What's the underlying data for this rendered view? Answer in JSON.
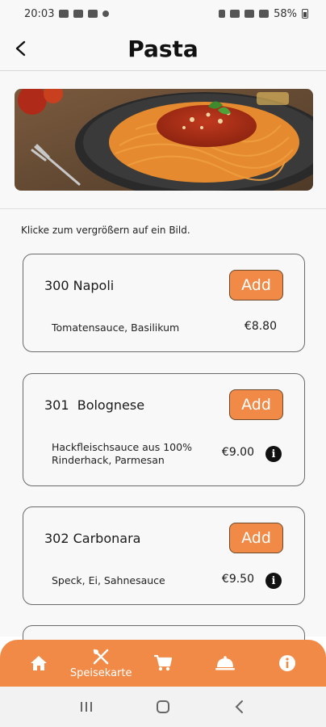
{
  "status_bar": {
    "time": "20:03",
    "battery": "58%"
  },
  "header": {
    "title": "Pasta"
  },
  "hint": "Klicke zum vergrößern auf ein Bild.",
  "menu_items": [
    {
      "name": "300 Napoli",
      "description": "Tomatensauce, Basilikum",
      "price": "€8.80",
      "add_label": "Add",
      "has_info": false
    },
    {
      "name": "301  Bolognese",
      "description_lines": [
        "Hackfleischsauce aus 100%",
        "Rinderhack, Parmesan"
      ],
      "price": "€9.00",
      "add_label": "Add",
      "has_info": true
    },
    {
      "name": "302 Carbonara",
      "description": "Speck, Ei, Sahnesauce",
      "price": "€9.50",
      "add_label": "Add",
      "has_info": true
    }
  ],
  "bottom_nav": {
    "items": [
      {
        "icon": "home-icon"
      },
      {
        "icon": "cutlery-icon",
        "label": "Speisekarte",
        "active": true
      },
      {
        "icon": "cart-icon"
      },
      {
        "icon": "cloche-icon"
      },
      {
        "icon": "info-icon"
      }
    ]
  },
  "colors": {
    "accent": "#f08a46",
    "background": "#f8f8f8",
    "border": "#6a6a6a"
  }
}
